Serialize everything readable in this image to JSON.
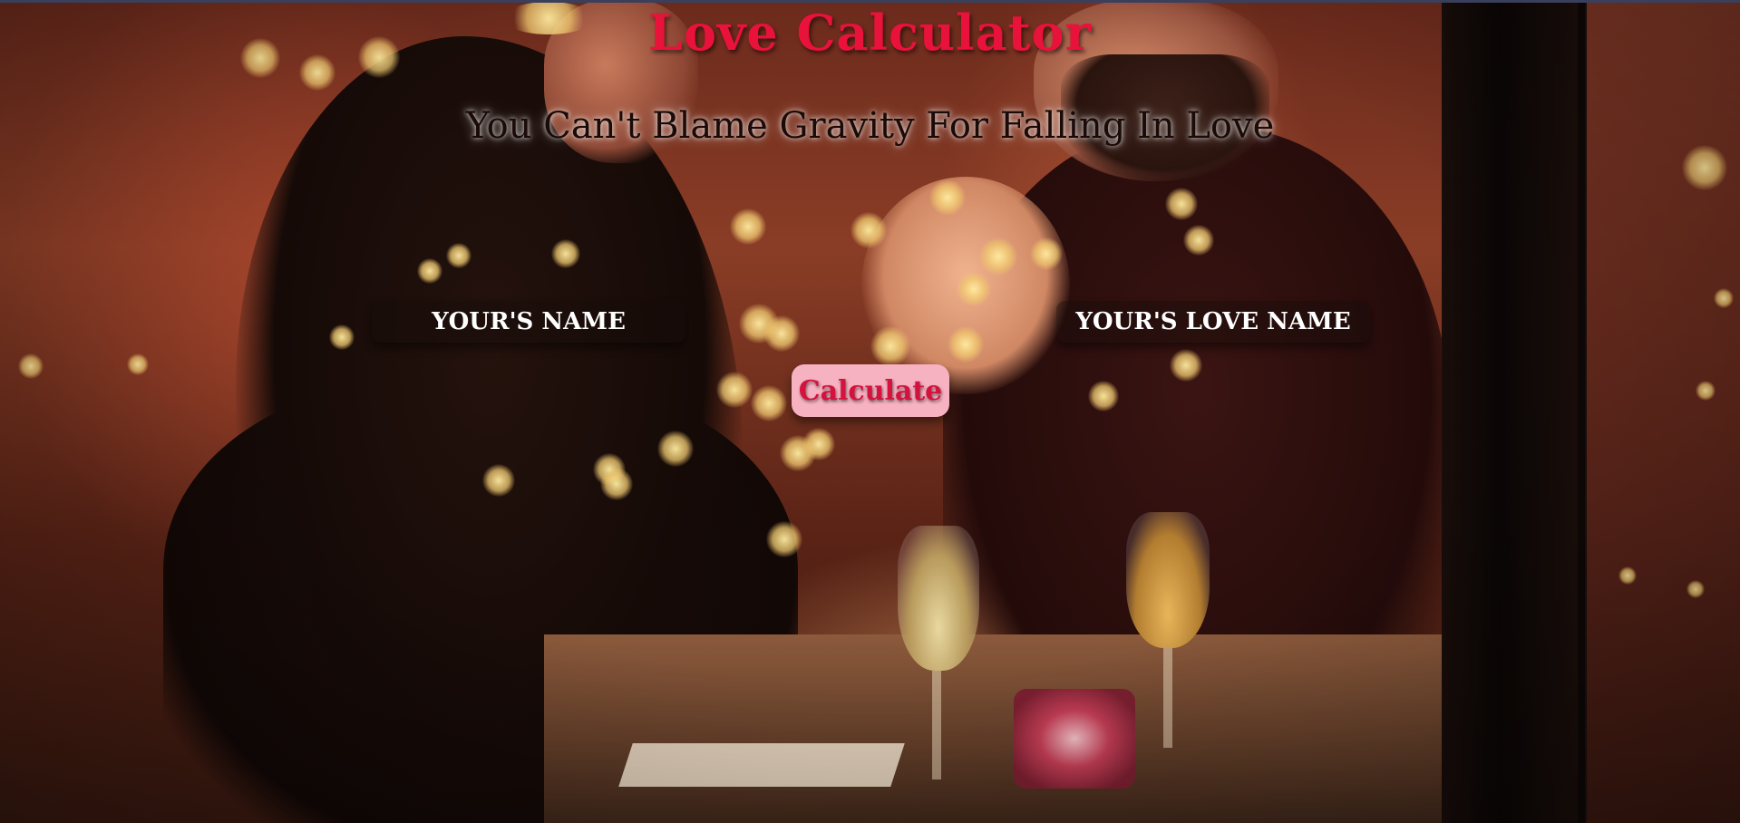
{
  "header": {
    "title": "Love Calculator",
    "subtitle": "You Can't Blame Gravity For Falling In Love"
  },
  "form": {
    "your_name_placeholder": "YOUR'S NAME",
    "love_name_placeholder": "YOUR'S LOVE NAME",
    "calculate_label": "Calculate"
  },
  "colors": {
    "title": "#e8123a",
    "button_background": "#f7b2c2",
    "button_text": "#d4123d",
    "subtitle_text": "#1a0a08"
  }
}
